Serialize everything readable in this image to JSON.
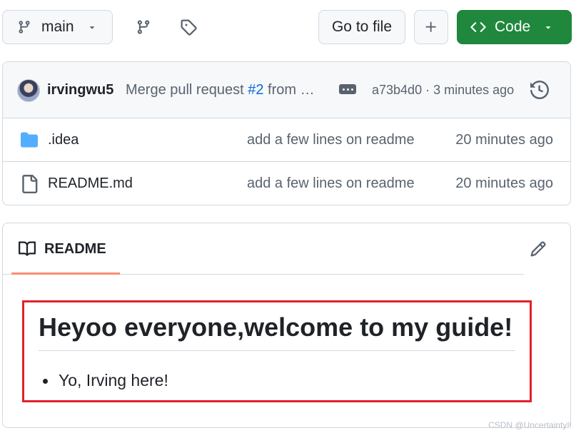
{
  "toolbar": {
    "branch_label": "main",
    "go_to_file_label": "Go to file",
    "code_label": "Code"
  },
  "commit": {
    "author": "irvingwu5",
    "message_prefix": "Merge pull request ",
    "pr_ref": "#2",
    "message_suffix": " from …",
    "sha": "a73b4d0",
    "separator": " · ",
    "time": "3 minutes ago"
  },
  "files": [
    {
      "name": ".idea",
      "type": "folder",
      "message": "add a few lines on readme",
      "time": "20 minutes ago"
    },
    {
      "name": "README.md",
      "type": "file",
      "message": "add a few lines on readme",
      "time": "20 minutes ago"
    }
  ],
  "readme": {
    "tab_label": "README",
    "heading": "Heyoo everyone,welcome to my guide!",
    "items": [
      "Yo, Irving here!"
    ]
  },
  "watermark": "CSDN @Uncertainty!!",
  "colors": {
    "accent_green": "#1f883d",
    "link_blue": "#0969da",
    "folder_blue": "#54aeff",
    "highlight_red": "#e3202a",
    "tab_underline": "#fd8c73"
  }
}
